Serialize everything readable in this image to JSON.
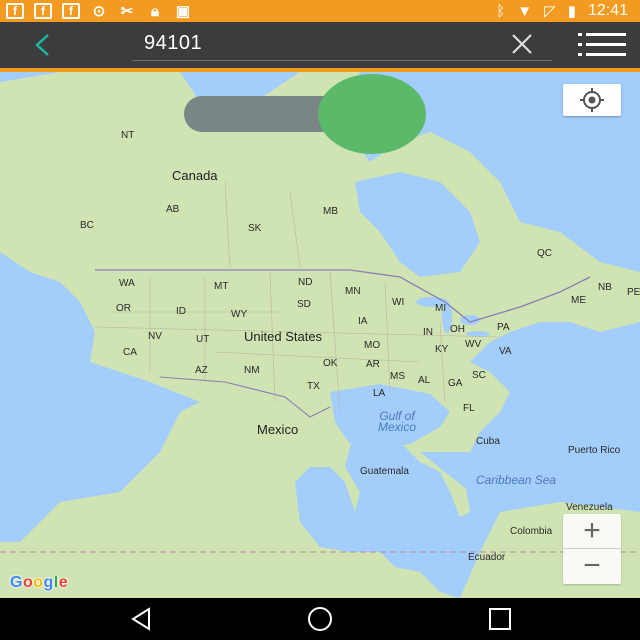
{
  "status_bar": {
    "time": "12:41",
    "left_icons": [
      "facebook-icon",
      "facebook-icon",
      "facebook-icon",
      "alarm-icon",
      "tools-icon",
      "lock-icon",
      "android-icon"
    ],
    "right_icons": [
      "bluetooth-icon",
      "wifi-icon",
      "no-signal-icon",
      "battery-charging-icon"
    ]
  },
  "toolbar": {
    "search_value": "94101",
    "accent_color": "#18b9a3"
  },
  "map": {
    "labels": {
      "nt": "NT",
      "canada": "Canada",
      "ab": "AB",
      "bc": "BC",
      "sk": "SK",
      "mb": "MB",
      "qc": "QC",
      "wa": "WA",
      "mt": "MT",
      "nd": "ND",
      "mn": "MN",
      "sd": "SD",
      "wi": "WI",
      "mi": "MI",
      "me": "ME",
      "nb": "NB",
      "pe": "PE",
      "or": "OR",
      "id": "ID",
      "wy": "WY",
      "us": "United States",
      "ia": "IA",
      "in": "IN",
      "oh": "OH",
      "pa": "PA",
      "nv": "NV",
      "ut": "UT",
      "mo": "MO",
      "ky": "KY",
      "wv": "WV",
      "va": "VA",
      "ca": "CA",
      "ok": "OK",
      "ar": "AR",
      "az": "AZ",
      "nm": "NM",
      "ms": "MS",
      "al": "AL",
      "ga": "GA",
      "sc": "SC",
      "tx": "TX",
      "la": "LA",
      "fl": "FL",
      "gulf": "Gulf of Mexico",
      "mexico": "Mexico",
      "cuba": "Cuba",
      "pr": "Puerto Rico",
      "guatemala": "Guatemala",
      "caribbean": "Caribbean Sea",
      "venezuela": "Venezuela",
      "colombia": "Colombia",
      "ecuador": "Ecuador"
    },
    "zoom_in": "+",
    "zoom_out": "−",
    "attribution": [
      "G",
      "o",
      "o",
      "g",
      "l",
      "e"
    ]
  },
  "toggle": {
    "state": "on",
    "track_color": "#7a8585",
    "knob_color": "#5bba6a"
  }
}
